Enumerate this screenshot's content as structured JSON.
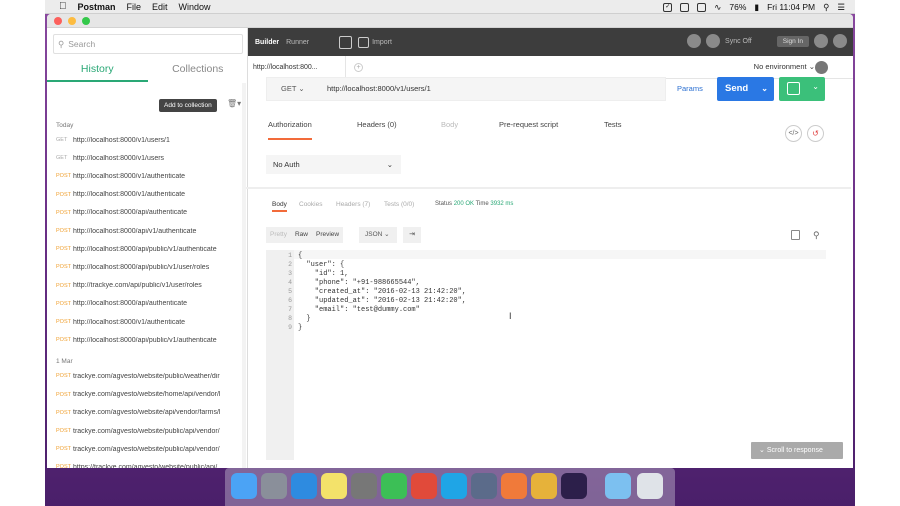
{
  "menubar": {
    "app": "Postman",
    "items": [
      "File",
      "Edit",
      "Window"
    ],
    "battery": "76%",
    "clock": "Fri 11:04 PM"
  },
  "sidebar": {
    "search_placeholder": "Search",
    "tabs": [
      {
        "label": "History",
        "active": true
      },
      {
        "label": "Collections",
        "active": false
      }
    ],
    "add_to_collection": "Add to collection",
    "groups": [
      {
        "label": "Today",
        "rows": [
          {
            "method": "GET",
            "url": "http://localhost:8000/v1/users/1"
          },
          {
            "method": "GET",
            "url": "http://localhost:8000/v1/users"
          },
          {
            "method": "POST",
            "url": "http://localhost:8000/v1/authenticate"
          },
          {
            "method": "POST",
            "url": "http://localhost:8000/v1/authenticate"
          },
          {
            "method": "POST",
            "url": "http://localhost:8000/api/authenticate"
          },
          {
            "method": "POST",
            "url": "http://localhost:8000/api/v1/authenticate"
          },
          {
            "method": "POST",
            "url": "http://localhost:8000/api/public/v1/authenticate"
          },
          {
            "method": "POST",
            "url": "http://localhost:8000/api/public/v1/user/roles"
          },
          {
            "method": "POST",
            "url": "http://trackye.com/api/public/v1/user/roles"
          },
          {
            "method": "POST",
            "url": "http://localhost:8000/api/authenticate"
          },
          {
            "method": "POST",
            "url": "http://localhost:8000/v1/authenticate"
          },
          {
            "method": "POST",
            "url": "http://localhost:8000/api/public/v1/authenticate"
          }
        ]
      },
      {
        "label": "1 Mar",
        "rows": [
          {
            "method": "POST",
            "url": "trackye.com/agvesto/website/public/weather/dir"
          },
          {
            "method": "POST",
            "url": "trackye.com/agvesto/website/home/api/vendor/l"
          },
          {
            "method": "POST",
            "url": "trackye.com/agvesto/website/api/vendor/farms/l"
          },
          {
            "method": "POST",
            "url": "trackye.com/agvesto/website/public/api/vendor/"
          },
          {
            "method": "POST",
            "url": "trackye.com/agvesto/website/public/api/vendor/"
          },
          {
            "method": "POST",
            "url": "https://trackye.com/agvesto/website/public/api/"
          }
        ]
      }
    ]
  },
  "toolbar": {
    "builder": "Builder",
    "runner": "Runner",
    "import": "Import",
    "sync": "Sync Off",
    "sign_in": "Sign In"
  },
  "request": {
    "tab_label": "http://localhost:800...",
    "environment": "No environment",
    "method": "GET",
    "url": "http://localhost:8000/v1/users/1",
    "params": "Params",
    "send": "Send",
    "tabs": [
      {
        "label": "Authorization",
        "active": true
      },
      {
        "label": "Headers (0)"
      },
      {
        "label": "Body",
        "disabled": true
      },
      {
        "label": "Pre-request script"
      },
      {
        "label": "Tests"
      }
    ],
    "auth_type": "No Auth"
  },
  "response": {
    "tabs": [
      {
        "label": "Body",
        "active": true
      },
      {
        "label": "Cookies"
      },
      {
        "label": "Headers (7)"
      },
      {
        "label": "Tests (0/0)"
      }
    ],
    "status_label": "Status",
    "status_value": "200 OK",
    "time_label": "Time",
    "time_value": "3932 ms",
    "format_buttons": [
      "Pretty",
      "Raw",
      "Preview"
    ],
    "format": "JSON",
    "code_lines": [
      {
        "n": "1",
        "text": "{"
      },
      {
        "n": "2",
        "text": "  \"user\": {"
      },
      {
        "n": "3",
        "text": "    \"id\": 1,"
      },
      {
        "n": "4",
        "text": "    \"phone\": \"+91-988665544\","
      },
      {
        "n": "5",
        "text": "    \"created_at\": \"2016-02-13 21:42:20\","
      },
      {
        "n": "6",
        "text": "    \"updated_at\": \"2016-02-13 21:42:20\","
      },
      {
        "n": "7",
        "text": "    \"email\": \"test@dummy.com\""
      },
      {
        "n": "8",
        "text": "  }"
      },
      {
        "n": "9",
        "text": "}"
      }
    ],
    "scroll_to_response": "Scroll to response"
  }
}
